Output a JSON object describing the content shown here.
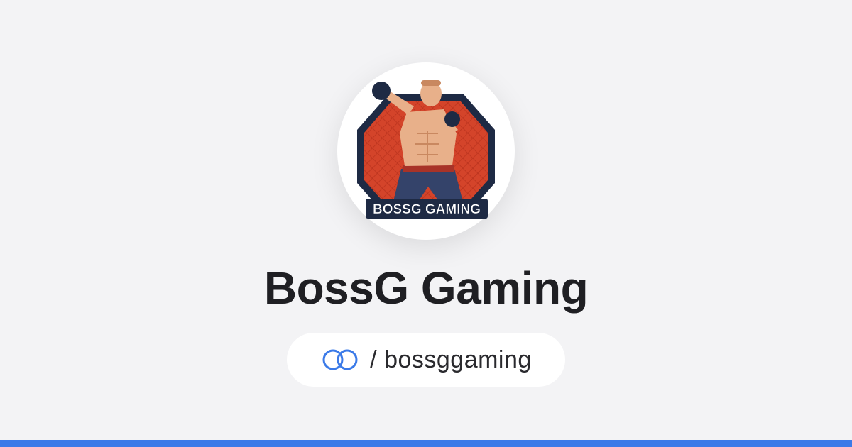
{
  "profile": {
    "name": "BossG Gaming",
    "handle": "/ bossggaming",
    "avatar_logo_text": "BOSSG GAMING"
  },
  "icons": {
    "link_icon": "linked-rings-icon"
  },
  "colors": {
    "background": "#f3f3f5",
    "name_text": "#1f1f23",
    "accent_blue": "#3b7ae8",
    "logo_red": "#d4442a",
    "logo_navy": "#1e2a44"
  }
}
